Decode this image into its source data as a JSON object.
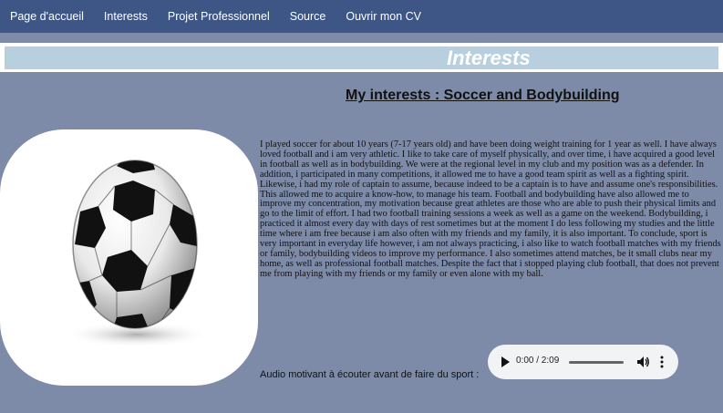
{
  "nav": {
    "items": [
      {
        "label": "Page d'accueil"
      },
      {
        "label": "Interests"
      },
      {
        "label": "Projet Professionnel"
      },
      {
        "label": "Source"
      },
      {
        "label": "Ouvrir mon CV"
      }
    ]
  },
  "page": {
    "title": "Interests",
    "heading": "My interests : Soccer and Bodybuilding",
    "paragraph": "I played soccer for about 10 years (7-17 years old) and have been doing weight training for 1 year as well. I have always loved football and i am very athletic. I like to take care of myself physically, and over time, i have acquired a good level in football as well as in bodybuilding. We were at the regional level in my club and my position was as a defender. In addition, i participated in many competitions, it allowed me to have a good team spirit as well as a fighting spirit. Likewise, i had my role of captain to assume, because indeed to be a captain is to have and assume one's responsibilities. This allowed me to acquire a know-how, to manage his team. Football and bodybuilding have also allowed me to improve my concentration, my motivation because great athletes are those who are able to push their physical limits and go to the limit of effort. I had two football training sessions a week as well as a game on the weekend. Bodybuilding, i practiced it almost every day with days of rest sometimes but at the moment I do less following my studies and the little time where i am free because i am also often with my friends and my family, it is also important. To conclude, sport is very important in everyday life however, i am not always practicing, i also like to watch football matches with my friends or family, bodybuilding videos to improve my performance. I also sometimes attend matches, be it small clubs near my home, as well as professional football matches. Despite the fact that i stopped playing club football, that does not prevent me from playing with my friends or my family or even alone with my ball.",
    "audio_label": "Audio motivant à écouter avant de faire du sport :"
  },
  "audio": {
    "time": "0:00 / 2:09",
    "progress": 0
  },
  "colors": {
    "nav_bg": "#3d5685",
    "page_bg": "#7d8ba8",
    "title_bar": "#b8cfe0"
  }
}
